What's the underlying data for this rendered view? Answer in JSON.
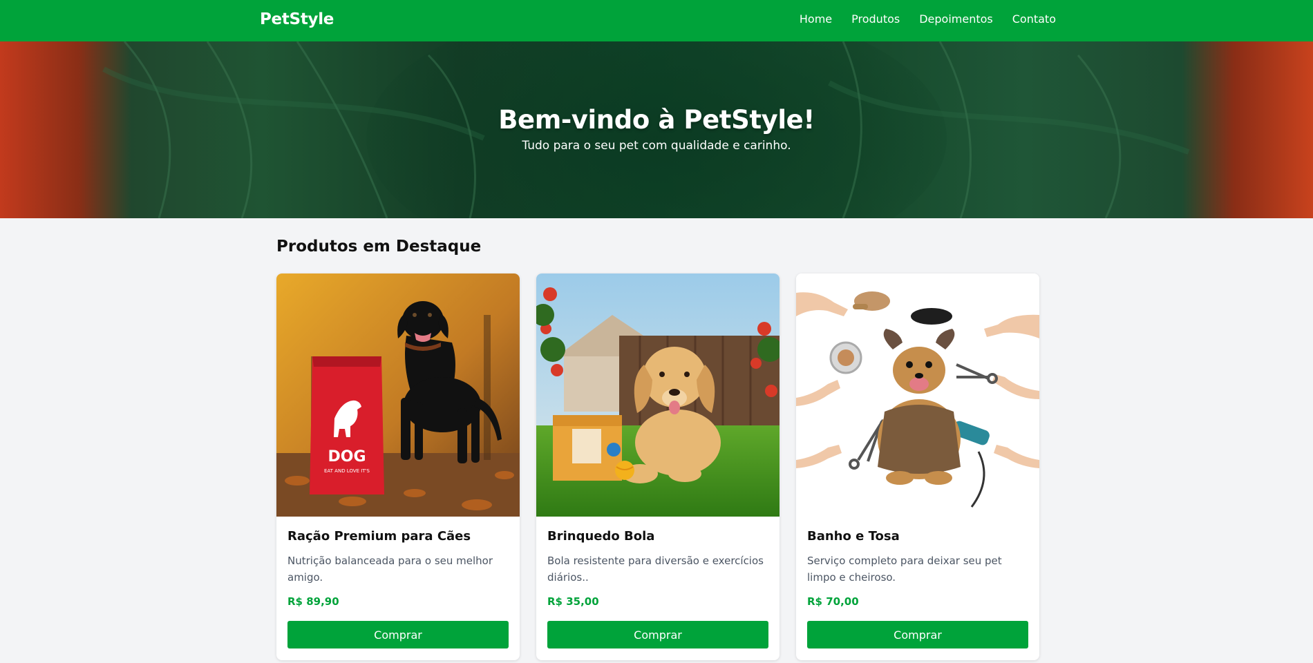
{
  "brand": "PetStyle",
  "colors": {
    "primary": "#00a33a",
    "background": "#f3f4f6"
  },
  "nav": {
    "items": [
      {
        "label": "Home"
      },
      {
        "label": "Produtos"
      },
      {
        "label": "Depoimentos"
      },
      {
        "label": "Contato"
      }
    ]
  },
  "hero": {
    "title": "Bem-vindo à PetStyle!",
    "subtitle": "Tudo para o seu pet com qualidade e carinho."
  },
  "products_section": {
    "title": "Produtos em Destaque",
    "items": [
      {
        "name": "Ração Premium para Cães",
        "description": "Nutrição balanceada para o seu melhor amigo.",
        "price": "R$ 89,90",
        "button": "Comprar",
        "image_text": "DOG",
        "image_subtext": "EAT AND LOVE IT'S"
      },
      {
        "name": "Brinquedo Bola",
        "description": "Bola resistente para diversão e exercícios diários..",
        "price": "R$ 35,00",
        "button": "Comprar"
      },
      {
        "name": "Banho e Tosa",
        "description": "Serviço completo para deixar seu pet limpo e cheiroso.",
        "price": "R$ 70,00",
        "button": "Comprar"
      }
    ]
  }
}
